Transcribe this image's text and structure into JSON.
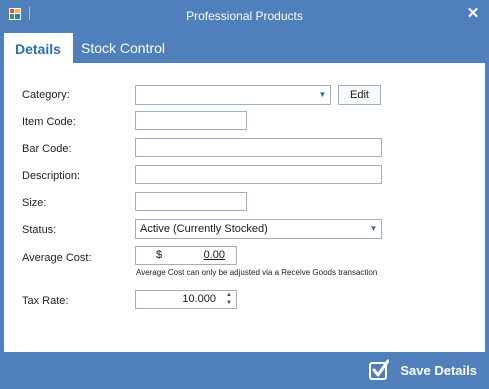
{
  "window": {
    "title": "Professional Products"
  },
  "tabs": [
    {
      "label": "Details",
      "active": true
    },
    {
      "label": "Stock Control",
      "active": false
    }
  ],
  "form": {
    "category": {
      "label": "Category:",
      "value": ""
    },
    "edit_button": "Edit",
    "item_code": {
      "label": "Item Code:",
      "value": ""
    },
    "bar_code": {
      "label": "Bar Code:",
      "value": ""
    },
    "description": {
      "label": "Description:",
      "value": ""
    },
    "size": {
      "label": "Size:",
      "value": ""
    },
    "status": {
      "label": "Status:",
      "value": "Active (Currently Stocked)"
    },
    "average_cost": {
      "label": "Average Cost:",
      "currency": "$",
      "value": "0.00",
      "note": "Average Cost can only be adjusted via a Receive Goods transaction"
    },
    "tax_rate": {
      "label": "Tax Rate:",
      "value": "10.000"
    }
  },
  "footer": {
    "save_label": "Save Details"
  },
  "icons": [
    "app-icon",
    "close-icon",
    "dropdown-arrow-icon",
    "spin-up-icon",
    "spin-down-icon",
    "checkmark-icon"
  ],
  "colors": {
    "chrome": "#4f80bb",
    "accent": "#2f6eab",
    "panel": "#ffffff"
  }
}
